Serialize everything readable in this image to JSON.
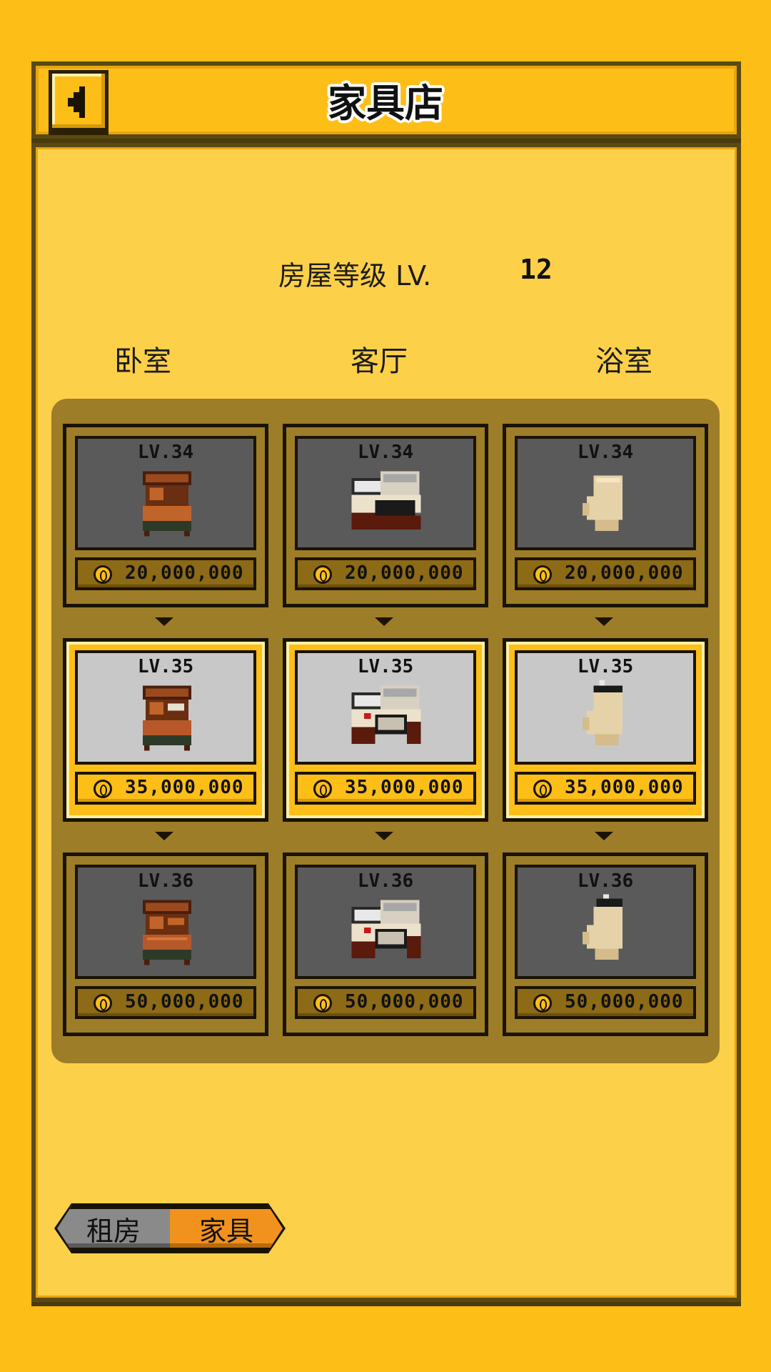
{
  "header": {
    "title": "家具店",
    "back_icon": "back-arrow-icon"
  },
  "house": {
    "level_label": "房屋等级 LV.",
    "level_value": "12"
  },
  "columns": [
    {
      "label": "卧室"
    },
    {
      "label": "客厅"
    },
    {
      "label": "浴室"
    }
  ],
  "rows": [
    {
      "state": "owned",
      "items": [
        {
          "level": "LV.34",
          "price": "20,000,000",
          "icon": "bed-icon"
        },
        {
          "level": "LV.34",
          "price": "20,000,000",
          "icon": "kitchen-counter-icon"
        },
        {
          "level": "LV.34",
          "price": "20,000,000",
          "icon": "toilet-icon"
        }
      ]
    },
    {
      "state": "current",
      "items": [
        {
          "level": "LV.35",
          "price": "35,000,000",
          "icon": "bed-icon"
        },
        {
          "level": "LV.35",
          "price": "35,000,000",
          "icon": "kitchen-counter-icon"
        },
        {
          "level": "LV.35",
          "price": "35,000,000",
          "icon": "toilet-icon"
        }
      ]
    },
    {
      "state": "locked",
      "items": [
        {
          "level": "LV.36",
          "price": "50,000,000",
          "icon": "bed-icon"
        },
        {
          "level": "LV.36",
          "price": "50,000,000",
          "icon": "kitchen-counter-icon"
        },
        {
          "level": "LV.36",
          "price": "50,000,000",
          "icon": "toilet-icon"
        }
      ]
    }
  ],
  "tabs": [
    {
      "label": "租房",
      "selected": false
    },
    {
      "label": "家具",
      "selected": true
    }
  ],
  "colors": {
    "background": "#FDBE18",
    "panel": "#FDD049",
    "grid": "#9D7D28",
    "active_tab": "#F2921E",
    "inactive_tab": "#8a8a8a"
  }
}
